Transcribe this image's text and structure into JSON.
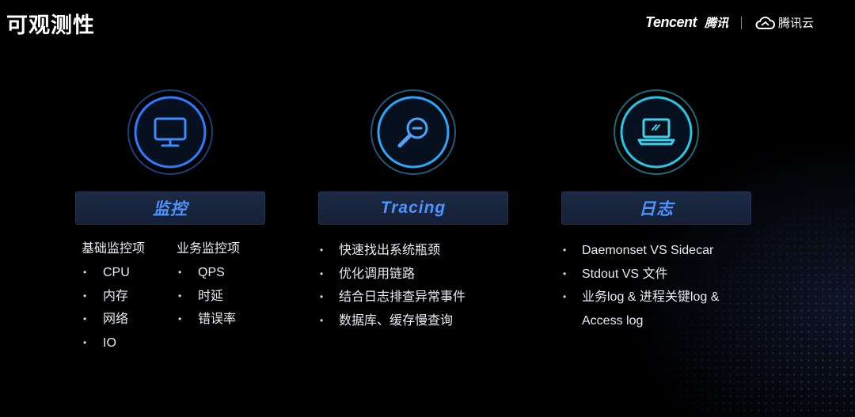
{
  "page": {
    "title": "可观测性"
  },
  "brand": {
    "tencent": "Tencent",
    "tencent_cn": "腾讯",
    "cloud": "腾讯云"
  },
  "columns": [
    {
      "icon": "monitor-icon",
      "label": "监控",
      "groups": [
        {
          "title": "基础监控项",
          "items": [
            "CPU",
            "内存",
            "网络",
            "IO"
          ]
        },
        {
          "title": "业务监控项",
          "items": [
            "QPS",
            "时延",
            "错误率"
          ]
        }
      ]
    },
    {
      "icon": "magnifier-icon",
      "label": "Tracing",
      "items": [
        "快速找出系统瓶颈",
        "优化调用链路",
        "结合日志排查异常事件",
        "数据库、缓存慢查询"
      ]
    },
    {
      "icon": "laptop-icon",
      "label": "日志",
      "items": [
        "Daemonset VS Sidecar",
        "Stdout VS 文件",
        "业务log & 进程关键log &",
        "Access log"
      ]
    }
  ],
  "colors": {
    "accent_blue": "#2f7bff",
    "accent_cyan": "#27c6e6",
    "label_text": "#4e93ff",
    "label_bg": "#1c2a46"
  }
}
